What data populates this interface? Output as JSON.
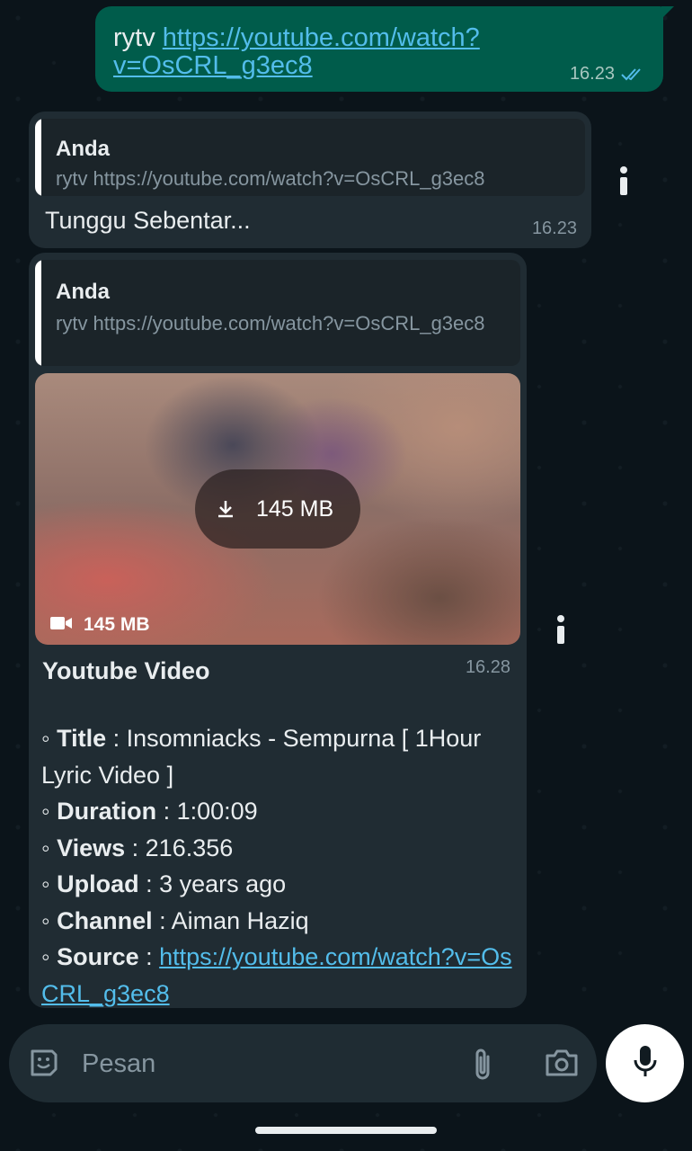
{
  "messages": {
    "outgoing": {
      "prefix": "rytv",
      "link": "https://youtube.com/watch?v=OsCRL_g3ec8",
      "time": "16.23"
    },
    "reply1": {
      "quote_author": "Anda",
      "quote_text": "rytv https://youtube.com/watch?v=OsCRL_g3ec8",
      "body": "Tunggu Sebentar...",
      "time": "16.23"
    },
    "reply2": {
      "quote_author": "Anda",
      "quote_text": "rytv https://youtube.com/watch?v=OsCRL_g3ec8",
      "download_size": "145 MB",
      "video_size": "145 MB",
      "title": "Youtube Video",
      "time": "16.28",
      "details": {
        "title_label": "Title",
        "title_value": ": Insomniacks - Sempurna [ 1Hour Lyric Video ]",
        "duration_label": "Duration",
        "duration_value": ": 1:00:09",
        "views_label": "Views",
        "views_value": ": 216.356",
        "upload_label": "Upload",
        "upload_value": ": 3 years ago",
        "channel_label": "Channel",
        "channel_value": ": Aiman Haziq",
        "source_label": "Source",
        "source_sep": " : ",
        "source_link": "https://youtube.com/watch?v=OsCRL_g3ec8"
      }
    }
  },
  "input": {
    "placeholder": "Pesan"
  },
  "colors": {
    "background": "#0b141a",
    "outgoing_bubble": "#005c4b",
    "incoming_bubble": "#202c33",
    "link": "#53bdeb",
    "read_ticks": "#53bdeb"
  }
}
